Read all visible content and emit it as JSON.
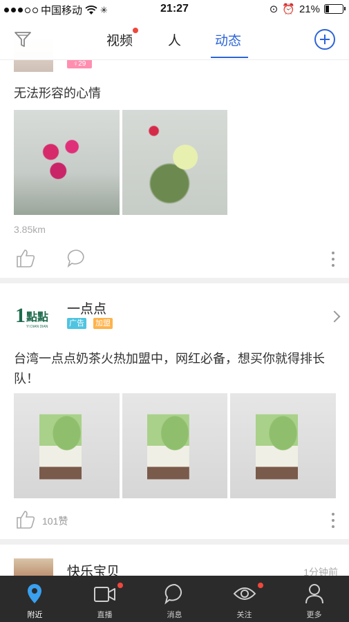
{
  "status_bar": {
    "carrier": "中国移动",
    "time": "21:27",
    "battery": "21%"
  },
  "top_nav": {
    "tabs": [
      {
        "label": "视频",
        "badge": true
      },
      {
        "label": "人",
        "badge": false
      },
      {
        "label": "动态",
        "badge": false,
        "active": true
      }
    ],
    "accent_color": "#2b64d8"
  },
  "posts": [
    {
      "age_badge": "29",
      "text": "无法形容的心情",
      "images": [
        "flower-photo-1",
        "flower-photo-2"
      ],
      "distance": "3.85km"
    },
    {
      "name": "一点点",
      "tags": [
        "广告",
        "加盟"
      ],
      "text": "台湾一点点奶茶火热加盟中，网红必备，想买你就得排长队！",
      "images": [
        "milk-tea-photo-1",
        "milk-tea-photo-2",
        "milk-tea-photo-3"
      ],
      "likes": "101赞"
    },
    {
      "name": "快乐宝贝",
      "time": "1分钟前"
    }
  ],
  "bottom_tabs": [
    {
      "label": "附近",
      "icon": "location-pin-icon",
      "active": true,
      "badge": false
    },
    {
      "label": "直播",
      "icon": "video-camera-icon",
      "active": false,
      "badge": true
    },
    {
      "label": "消息",
      "icon": "chat-bubble-icon",
      "active": false,
      "badge": false
    },
    {
      "label": "关注",
      "icon": "eye-icon",
      "active": false,
      "badge": true
    },
    {
      "label": "更多",
      "icon": "person-icon",
      "active": false,
      "badge": false
    }
  ]
}
